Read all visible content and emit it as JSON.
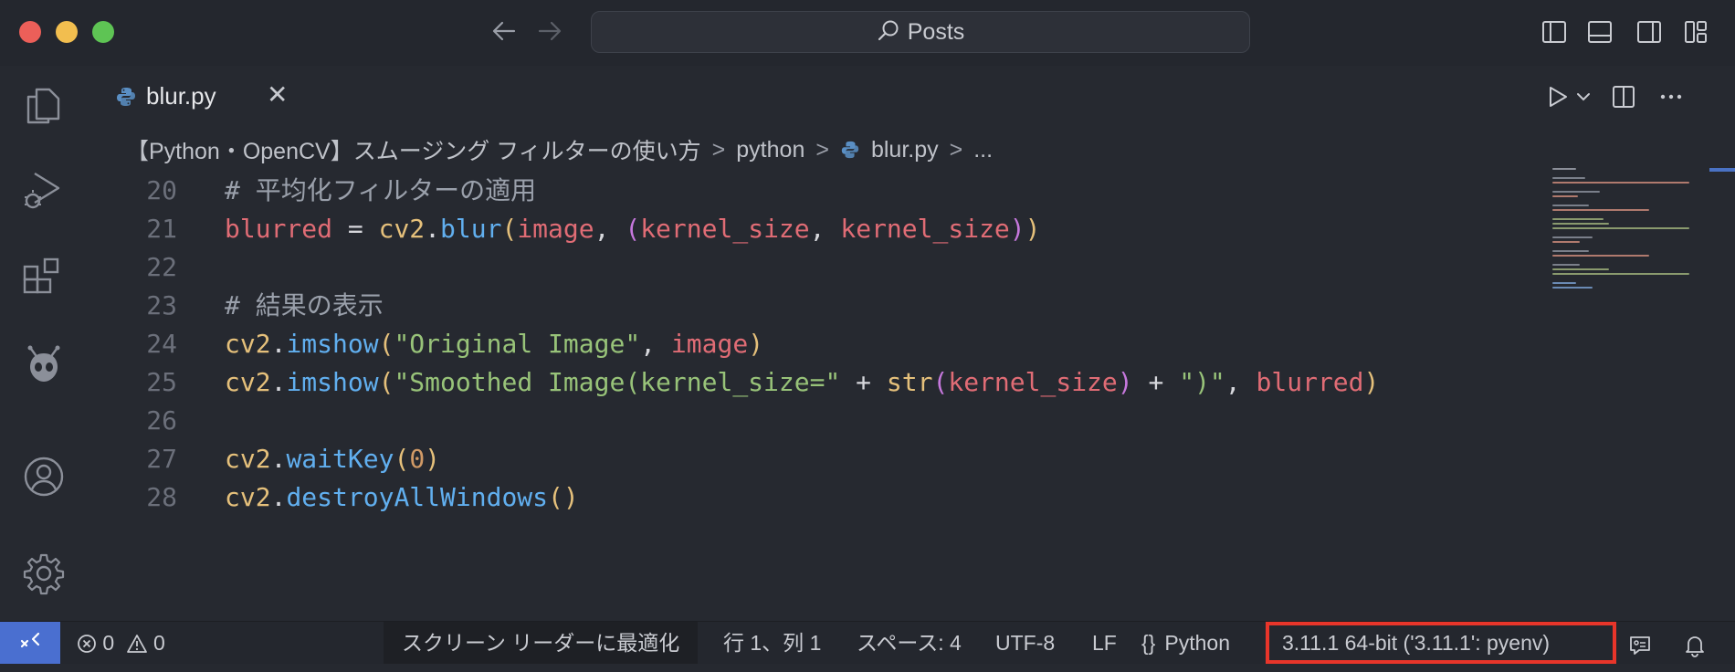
{
  "titlebar": {
    "search_text": "Posts"
  },
  "tab": {
    "label": "blur.py",
    "close": "✕"
  },
  "breadcrumb": {
    "folder": "【Python・OpenCV】スムージング フィルターの使い方",
    "sep1": ">",
    "subfolder": "python",
    "sep2": ">",
    "file": "blur.py",
    "sep3": ">",
    "more": "..."
  },
  "code_lines": [
    {
      "n": "20",
      "text": "# 平均化フィルターの適用"
    },
    {
      "n": "21",
      "text": "blurred = cv2.blur(image, (kernel_size, kernel_size))"
    },
    {
      "n": "22",
      "text": ""
    },
    {
      "n": "23",
      "text": "# 結果の表示"
    },
    {
      "n": "24",
      "text": "cv2.imshow(\"Original Image\", image)"
    },
    {
      "n": "25",
      "text": "cv2.imshow(\"Smoothed Image(kernel_size=\" + str(kernel_size) + \")\", blurred)"
    },
    {
      "n": "26",
      "text": ""
    },
    {
      "n": "27",
      "text": "cv2.waitKey(0)"
    },
    {
      "n": "28",
      "text": "cv2.destroyAllWindows()"
    }
  ],
  "statusbar": {
    "errors": "0",
    "warnings": "0",
    "accessibility": "スクリーン リーダーに最適化",
    "position": "行 1、列 1",
    "indent": "スペース: 4",
    "encoding": "UTF-8",
    "eol": "LF",
    "language_icon": "{}",
    "language": "Python",
    "interpreter": "3.11.1 64-bit ('3.11.1': pyenv)"
  },
  "colors": {
    "highlight_box": "#e8352a",
    "remote_accent": "#4a6fd0",
    "traffic_red": "#ec5f59",
    "traffic_yellow": "#f2be4f",
    "traffic_green": "#5ec454"
  },
  "icons": {
    "activity": [
      "explorer-icon",
      "run-debug-icon",
      "extensions-icon",
      "alien-extension-icon",
      "account-icon",
      "settings-gear-icon"
    ],
    "editor_actions": [
      "run-icon",
      "chevron-down-icon",
      "split-editor-icon",
      "more-actions-icon"
    ]
  }
}
